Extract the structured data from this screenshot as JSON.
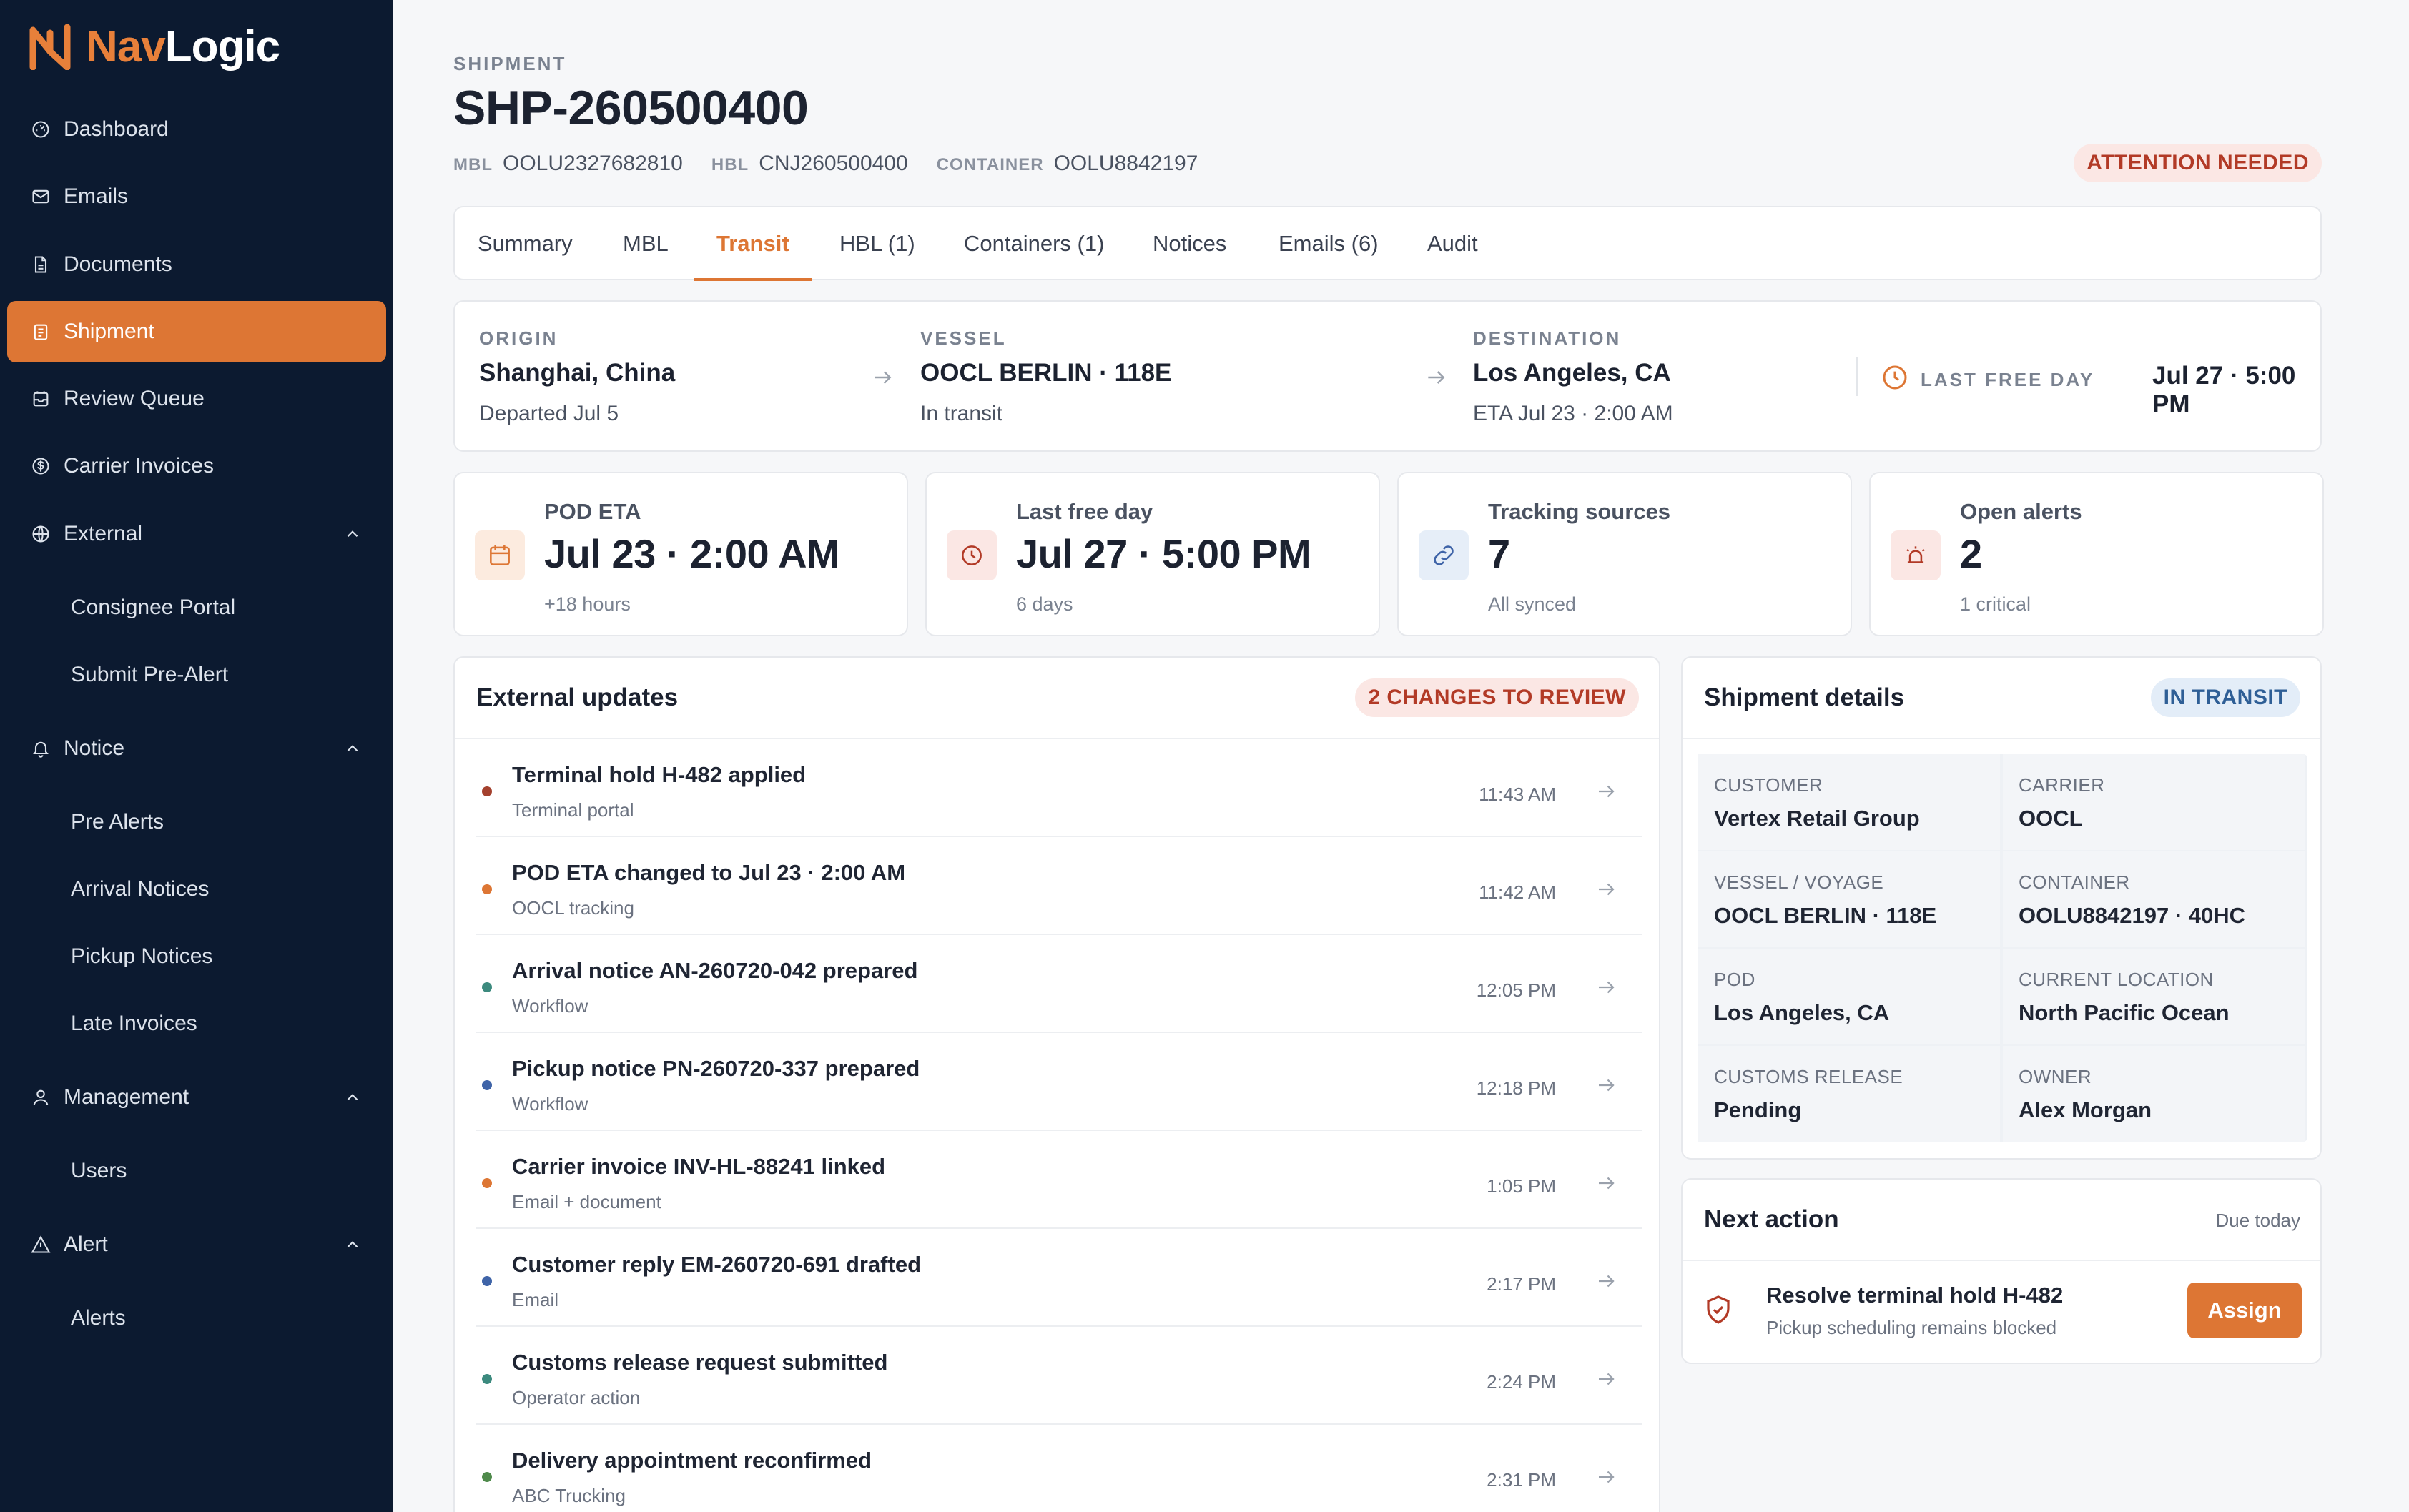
{
  "brand": {
    "name_a": "Nav",
    "name_b": "Logic",
    "accent": "#dd7634",
    "sidebar_bg": "#0c1a30"
  },
  "sidebar": {
    "items": [
      {
        "label": "Dashboard",
        "icon": "gauge-icon"
      },
      {
        "label": "Emails",
        "icon": "mail-icon"
      },
      {
        "label": "Documents",
        "icon": "document-icon"
      },
      {
        "label": "Shipment",
        "icon": "clipboard-icon",
        "active": true
      },
      {
        "label": "Review Queue",
        "icon": "inbox-icon"
      },
      {
        "label": "Carrier Invoices",
        "icon": "dollar-icon"
      },
      {
        "label": "External",
        "icon": "globe-icon",
        "expanded": true
      },
      {
        "label": "Notice",
        "icon": "bell-icon",
        "expanded": true
      },
      {
        "label": "Management",
        "icon": "user-icon",
        "expanded": true
      },
      {
        "label": "Alert",
        "icon": "warning-icon",
        "expanded": true
      }
    ],
    "sub": {
      "external": [
        "Consignee Portal",
        "Submit Pre-Alert"
      ],
      "notice": [
        "Pre Alerts",
        "Arrival Notices",
        "Pickup Notices",
        "Late Invoices"
      ],
      "management": [
        "Users"
      ],
      "alert": [
        "Alerts"
      ]
    }
  },
  "header": {
    "eyebrow": "SHIPMENT",
    "title": "SHP-260500400",
    "mbl_label": "MBL",
    "mbl": "OOLU2327682810",
    "hbl_label": "HBL",
    "hbl": "CNJ260500400",
    "container_label": "CONTAINER",
    "container": "OOLU8842197",
    "status": "ATTENTION NEEDED"
  },
  "tabs": [
    "Summary",
    "MBL",
    "Transit",
    "HBL (1)",
    "Containers (1)",
    "Notices",
    "Emails (6)",
    "Audit"
  ],
  "active_tab": "Transit",
  "route": {
    "origin_label": "ORIGIN",
    "origin": "Shanghai, China",
    "origin_sub": "Departed Jul 5",
    "vessel_label": "VESSEL",
    "vessel": "OOCL BERLIN · 118E",
    "vessel_sub": "In transit",
    "dest_label": "DESTINATION",
    "dest": "Los Angeles, CA",
    "dest_sub": "ETA Jul 23 · 2:00 AM",
    "lfd_label": "LAST FREE DAY",
    "lfd": "Jul 27 · 5:00 PM"
  },
  "stats": [
    {
      "label": "POD ETA",
      "value": "Jul 23 · 2:00 AM",
      "sub": "+18 hours",
      "icon": "calendar-icon"
    },
    {
      "label": "Last free day",
      "value": "Jul 27 · 5:00 PM",
      "sub": "6 days",
      "icon": "clock-icon"
    },
    {
      "label": "Tracking sources",
      "value": "7",
      "sub": "All synced",
      "icon": "link-icon"
    },
    {
      "label": "Open alerts",
      "value": "2",
      "sub": "1 critical",
      "icon": "alarm-icon"
    }
  ],
  "updates": {
    "title": "External updates",
    "badge": "2 CHANGES TO REVIEW",
    "rows": [
      {
        "title": "Terminal hold H-482 applied",
        "source": "Terminal portal",
        "time": "11:43 AM",
        "color": "#a4412e"
      },
      {
        "title": "POD ETA changed to Jul 23 · 2:00 AM",
        "source": "OOCL tracking",
        "time": "11:42 AM",
        "color": "#dd7634"
      },
      {
        "title": "Arrival notice AN-260720-042 prepared",
        "source": "Workflow",
        "time": "12:05 PM",
        "color": "#3c8a7e"
      },
      {
        "title": "Pickup notice PN-260720-337 prepared",
        "source": "Workflow",
        "time": "12:18 PM",
        "color": "#3f64a8"
      },
      {
        "title": "Carrier invoice INV-HL-88241 linked",
        "source": "Email + document",
        "time": "1:05 PM",
        "color": "#dd7634"
      },
      {
        "title": "Customer reply EM-260720-691 drafted",
        "source": "Email",
        "time": "2:17 PM",
        "color": "#3f64a8"
      },
      {
        "title": "Customs release request submitted",
        "source": "Operator action",
        "time": "2:24 PM",
        "color": "#3c8a7e"
      },
      {
        "title": "Delivery appointment reconfirmed",
        "source": "ABC Trucking",
        "time": "2:31 PM",
        "color": "#4f8a4b"
      }
    ]
  },
  "details": {
    "title": "Shipment details",
    "badge": "IN TRANSIT",
    "cells": [
      {
        "k": "CUSTOMER",
        "v": "Vertex Retail Group"
      },
      {
        "k": "CARRIER",
        "v": "OOCL"
      },
      {
        "k": "VESSEL / VOYAGE",
        "v": "OOCL BERLIN · 118E"
      },
      {
        "k": "CONTAINER",
        "v": "OOLU8842197 · 40HC"
      },
      {
        "k": "POD",
        "v": "Los Angeles, CA"
      },
      {
        "k": "CURRENT LOCATION",
        "v": "North Pacific Ocean"
      },
      {
        "k": "CUSTOMS RELEASE",
        "v": "Pending"
      },
      {
        "k": "OWNER",
        "v": "Alex Morgan"
      }
    ]
  },
  "next_action": {
    "title": "Next action",
    "due": "Due today",
    "task": "Resolve terminal hold H-482",
    "sub": "Pickup scheduling remains blocked",
    "button": "Assign"
  }
}
